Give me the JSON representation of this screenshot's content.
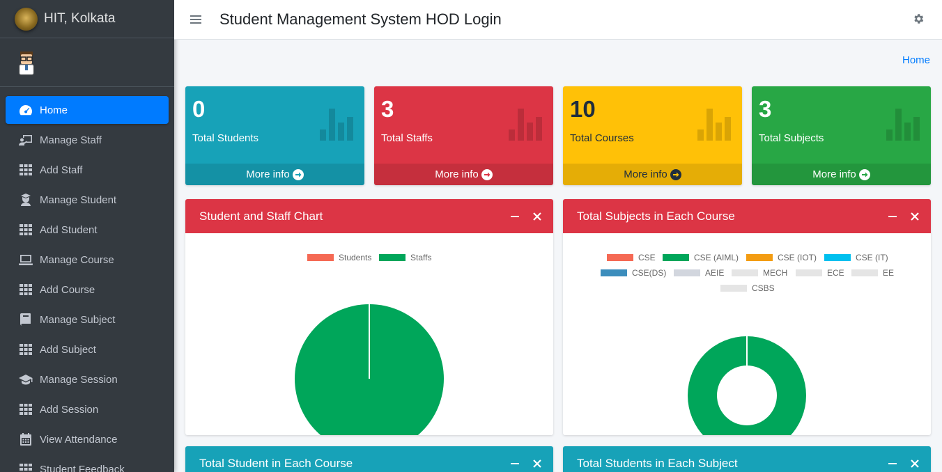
{
  "brand": {
    "name": "HIT, Kolkata"
  },
  "sidebar": {
    "items": [
      {
        "label": "Home",
        "icon": "tachometer-icon",
        "active": true
      },
      {
        "label": "Manage Staff",
        "icon": "chalkboard-teacher-icon"
      },
      {
        "label": "Add Staff",
        "icon": "grid-icon"
      },
      {
        "label": "Manage Student",
        "icon": "user-graduate-icon"
      },
      {
        "label": "Add Student",
        "icon": "grid-icon"
      },
      {
        "label": "Manage Course",
        "icon": "laptop-icon"
      },
      {
        "label": "Add Course",
        "icon": "grid-icon"
      },
      {
        "label": "Manage Subject",
        "icon": "book-icon"
      },
      {
        "label": "Add Subject",
        "icon": "grid-icon"
      },
      {
        "label": "Manage Session",
        "icon": "graduation-cap-icon"
      },
      {
        "label": "Add Session",
        "icon": "grid-icon"
      },
      {
        "label": "View Attendance",
        "icon": "calendar-icon"
      },
      {
        "label": "Student Feedback",
        "icon": "grid-icon"
      }
    ]
  },
  "header": {
    "title": "Student Management System HOD Login"
  },
  "breadcrumb": {
    "home": "Home"
  },
  "stats": [
    {
      "value": "0",
      "label": "Total Students",
      "more": "More info",
      "color": "#17a2b8"
    },
    {
      "value": "3",
      "label": "Total Staffs",
      "more": "More info",
      "color": "#dc3545"
    },
    {
      "value": "10",
      "label": "Total Courses",
      "more": "More info",
      "color": "#ffc107"
    },
    {
      "value": "3",
      "label": "Total Subjects",
      "more": "More info",
      "color": "#28a745"
    }
  ],
  "cards": {
    "staff_chart": {
      "title": "Student and Staff Chart"
    },
    "subjects_chart": {
      "title": "Total Subjects in Each Course"
    },
    "student_course": {
      "title": "Total Student in Each Course"
    },
    "student_subject": {
      "title": "Total Students in Each Subject"
    }
  },
  "chart_data": [
    {
      "type": "pie",
      "title": "Student and Staff Chart",
      "labels": [
        "Students",
        "Staffs"
      ],
      "values": [
        0,
        3
      ],
      "colors": [
        "#f56954",
        "#00a65a"
      ]
    },
    {
      "type": "pie",
      "title": "Total Subjects in Each Course",
      "variant": "doughnut",
      "labels": [
        "CSE",
        "CSE (AIML)",
        "CSE (IOT)",
        "CSE (IT)",
        "CSE(DS)",
        "AEIE",
        "MECH",
        "ECE",
        "EE",
        "CSBS"
      ],
      "values": [
        0,
        3,
        0,
        0,
        0,
        0,
        0,
        0,
        0,
        0
      ],
      "colors": [
        "#f56954",
        "#00a65a",
        "#f39c12",
        "#00c0ef",
        "#3c8dbc",
        "#d2d6de",
        "#e5e5e5",
        "#e5e5e5",
        "#e5e5e5",
        "#e5e5e5"
      ]
    }
  ]
}
